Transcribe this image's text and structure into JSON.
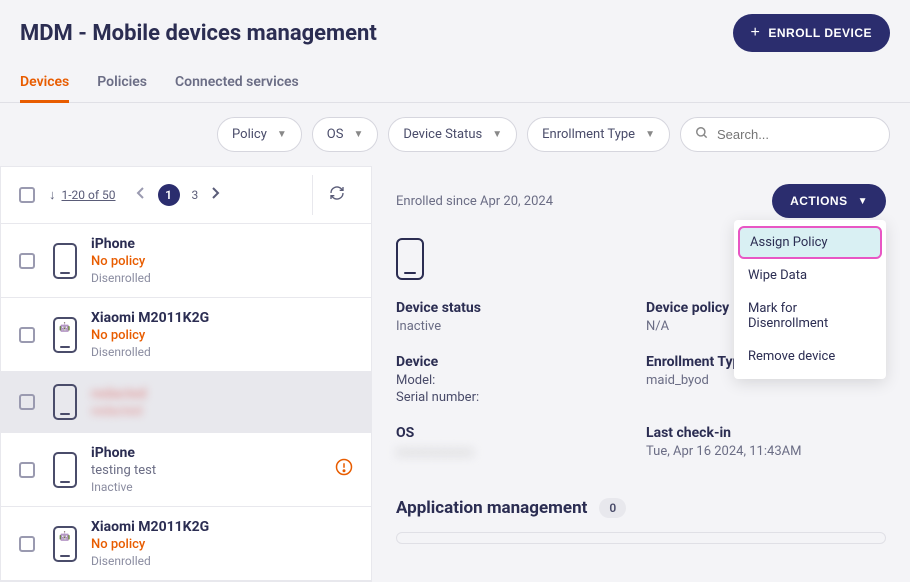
{
  "header": {
    "title": "MDM - Mobile devices management",
    "enroll_button": "ENROLL DEVICE"
  },
  "tabs": [
    {
      "label": "Devices",
      "active": true
    },
    {
      "label": "Policies",
      "active": false
    },
    {
      "label": "Connected services",
      "active": false
    }
  ],
  "filters": {
    "policy": "Policy",
    "os": "OS",
    "device_status": "Device Status",
    "enrollment_type": "Enrollment Type",
    "search_placeholder": "Search..."
  },
  "pagination": {
    "range_text": "1-20 of 50",
    "current_page": "1",
    "next_page": "3"
  },
  "devices": [
    {
      "name": "iPhone",
      "policy": "No policy",
      "status": "Disenrolled",
      "os": "apple",
      "policy_alert": true
    },
    {
      "name": "Xiaomi M2011K2G",
      "policy": "No policy",
      "status": "Disenrolled",
      "os": "android",
      "policy_alert": true
    },
    {
      "name": "redacted",
      "policy": "redacted",
      "status": "",
      "os": "apple",
      "selected": true,
      "blurred": true
    },
    {
      "name": "iPhone",
      "policy": "testing test",
      "status": "Inactive",
      "os": "apple",
      "warning": true
    },
    {
      "name": "Xiaomi M2011K2G",
      "policy": "No policy",
      "status": "Disenrolled",
      "os": "android",
      "policy_alert": true
    }
  ],
  "detail": {
    "enrolled_since": "Enrolled since Apr 20, 2024",
    "actions_label": "ACTIONS",
    "actions_menu": [
      "Assign Policy",
      "Wipe Data",
      "Mark for Disenrollment",
      "Remove device"
    ],
    "device_status_label": "Device status",
    "device_status_value": "Inactive",
    "device_label": "Device",
    "device_model_label": "Model:",
    "device_serial_label": "Serial number:",
    "os_label": "OS",
    "device_policy_label": "Device policy",
    "device_policy_value": "N/A",
    "enrollment_type_label": "Enrollment Type",
    "enrollment_type_value": "maid_byod",
    "last_checkin_label": "Last check-in",
    "last_checkin_value": "Tue, Apr 16 2024, 11:43AM",
    "app_mgmt_label": "Application management",
    "app_mgmt_count": "0"
  }
}
